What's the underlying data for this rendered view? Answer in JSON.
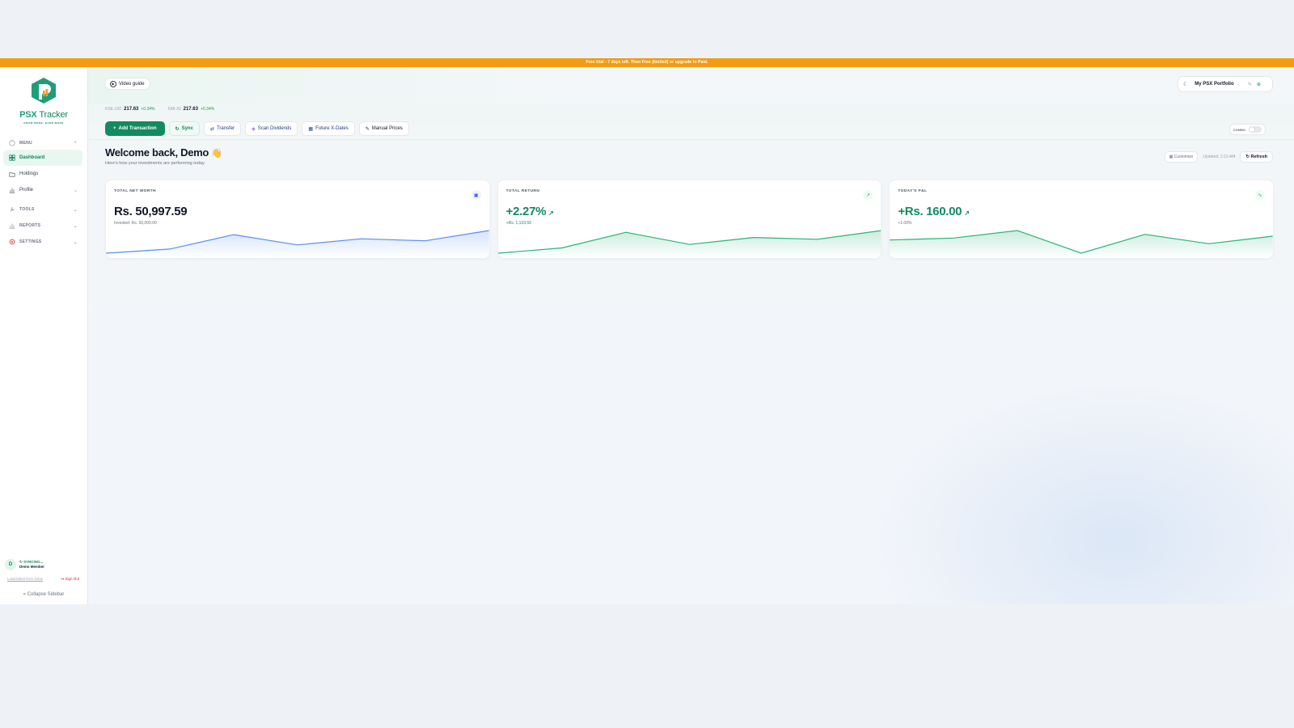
{
  "banner": {
    "text": "Free trial - 7 days left. Then Free (limited) or upgrade to Paid."
  },
  "brand": {
    "name_a": "PSX",
    "name_b": "Tracker",
    "tagline": "KNOW MORE. EARN MORE"
  },
  "sidebar": {
    "menu_label": "MENU",
    "items": [
      {
        "label": "Dashboard",
        "icon": "grid-icon",
        "active": true
      },
      {
        "label": "Holdings",
        "icon": "folder-icon"
      },
      {
        "label": "Profile",
        "icon": "chart-icon"
      }
    ],
    "tools_label": "TOOLS",
    "reports_label": "REPORTS",
    "settings_label": "SETTINGS",
    "user": {
      "initial": "D",
      "status": "↻ SYNCING...",
      "name": "Demo Member"
    },
    "load_link": "Load latest from Drive",
    "sign_out": "Sign Out",
    "collapse": "Collapse Sidebar"
  },
  "header": {
    "video_guide": "Video guide",
    "portfolio_name": "My PSX Portfolio"
  },
  "indices": [
    {
      "label": "KSE-100",
      "value": "217.63",
      "change": "+0.34%"
    },
    {
      "label": "KMI-30",
      "value": "217.63",
      "change": "+0.34%"
    }
  ],
  "actions": {
    "add": "Add Transaction",
    "sync": "Sync",
    "transfer": "Transfer",
    "scan": "Scan Dividends",
    "future": "Future X-Dates",
    "manual": "Manual Prices",
    "combo": "COMBO"
  },
  "welcome": {
    "title": "Welcome back, Demo",
    "emoji": "👋",
    "subtitle": "Here's how your investments are performing today."
  },
  "toolbar": {
    "customize": "Customize",
    "updated": "Updated: 2:10 AM",
    "refresh": "Refresh"
  },
  "cards": [
    {
      "label": "TOTAL NET WORTH",
      "value": "Rs. 50,997.59",
      "sub": "Invested: Rs. 50,000.00",
      "icon": "wallet-icon",
      "color": "#5b8def",
      "trend": [
        1,
        3,
        10,
        5,
        8,
        7,
        12
      ]
    },
    {
      "label": "TOTAL RETURN",
      "value": "+2.27%",
      "sub": "+Rs. 1,133.59",
      "icon": "trending-up-icon",
      "color": "#2bb37a",
      "trend": [
        2,
        5,
        14,
        7,
        11,
        10,
        15
      ]
    },
    {
      "label": "TODAY'S P&L",
      "value": "+Rs. 160.00",
      "sub": "+1.00%",
      "icon": "pulse-icon",
      "color": "#2bb37a",
      "trend": [
        8,
        9,
        13,
        1,
        11,
        6,
        10
      ]
    }
  ],
  "colors": {
    "brand": "#138a5f",
    "banner": "#f39c12",
    "positive": "#16a34a",
    "signout": "#dc2626"
  }
}
